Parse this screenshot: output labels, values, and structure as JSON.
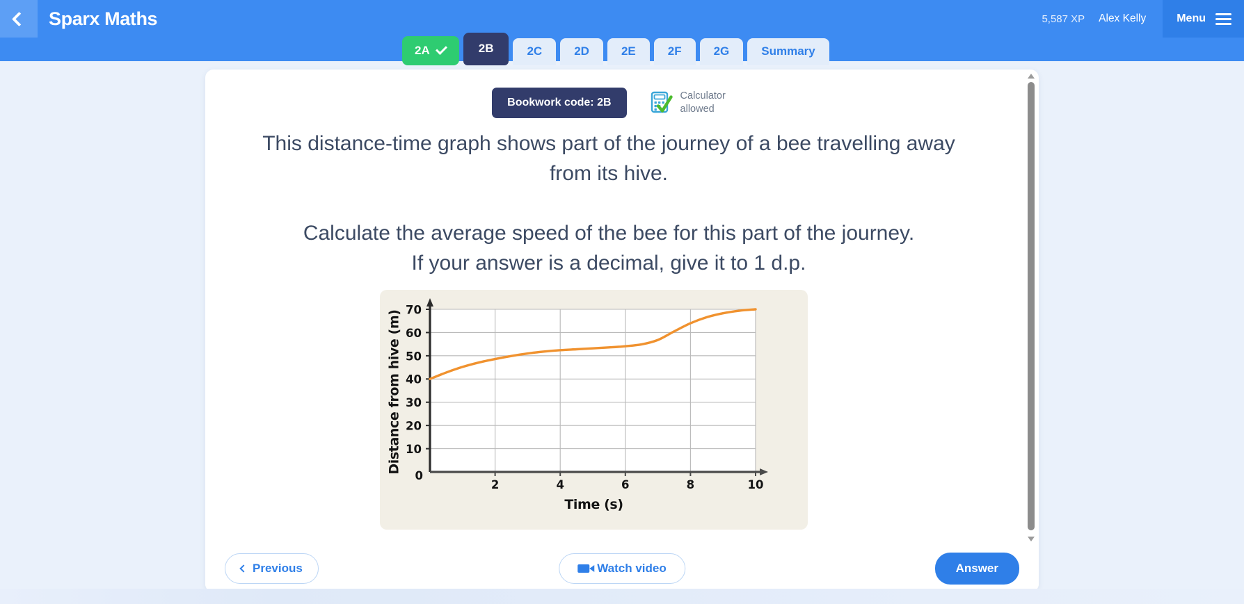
{
  "header": {
    "back_icon": "chevron-left-icon",
    "brand": "Sparx Maths",
    "xp": "5,587 XP",
    "user": "Alex Kelly",
    "menu_label": "Menu",
    "menu_icon": "hamburger-icon"
  },
  "tabs": [
    {
      "label": "2A",
      "state": "done"
    },
    {
      "label": "2B",
      "state": "current"
    },
    {
      "label": "2C",
      "state": "default"
    },
    {
      "label": "2D",
      "state": "default"
    },
    {
      "label": "2E",
      "state": "default"
    },
    {
      "label": "2F",
      "state": "default"
    },
    {
      "label": "2G",
      "state": "default"
    },
    {
      "label": "Summary",
      "state": "default"
    }
  ],
  "card": {
    "bookwork_code": "Bookwork code: 2B",
    "calculator_line1": "Calculator",
    "calculator_line2": "allowed",
    "calculator_icon": "calculator-allowed-icon",
    "question_paragraph_1": "This distance-time graph shows part of the journey of a bee travelling away from its hive.",
    "question_paragraph_2a": "Calculate the average speed of the bee for this part of the journey.",
    "question_paragraph_2b": "If your answer is a decimal, give it to 1 d.p."
  },
  "footer": {
    "previous": "Previous",
    "watch_video": "Watch video",
    "answer": "Answer"
  },
  "colors": {
    "header_blue": "#3d8bf2",
    "accent_blue": "#2f7fe8",
    "navy": "#323c6b",
    "green": "#2ecc71",
    "curve_orange": "#f0922f",
    "graph_bg": "#f2efe6",
    "page_bg": "#eaf1fb"
  },
  "chart_data": {
    "type": "line",
    "title": "",
    "xlabel": "Time (s)",
    "ylabel": "Distance from hive (m)",
    "xlim": [
      0,
      10
    ],
    "ylim": [
      0,
      70
    ],
    "xticks": [
      0,
      2,
      4,
      6,
      8,
      10
    ],
    "xtick_labels": [
      "0",
      "2",
      "4",
      "6",
      "8",
      "10"
    ],
    "yticks": [
      10,
      20,
      30,
      40,
      50,
      60,
      70
    ],
    "ytick_labels": [
      "10",
      "20",
      "30",
      "40",
      "50",
      "60",
      "70"
    ],
    "grid": "horizontal-and-vertical",
    "legend": "none",
    "series": [
      {
        "name": "Distance from hive",
        "color": "#f0922f",
        "x": [
          0,
          0.5,
          1,
          1.5,
          2,
          2.5,
          3,
          3.5,
          4,
          4.5,
          5,
          5.5,
          6,
          6.5,
          7,
          7.5,
          8,
          8.5,
          9,
          9.5,
          10
        ],
        "y": [
          40,
          42.8,
          45.2,
          47.1,
          48.6,
          49.9,
          51.0,
          51.8,
          52.4,
          52.8,
          53.2,
          53.6,
          54.1,
          54.9,
          56.8,
          60.5,
          64.0,
          66.6,
          68.3,
          69.4,
          70
        ]
      }
    ],
    "start_point": {
      "t": 0,
      "d": 40
    },
    "end_point": {
      "t": 10,
      "d": 70
    }
  }
}
